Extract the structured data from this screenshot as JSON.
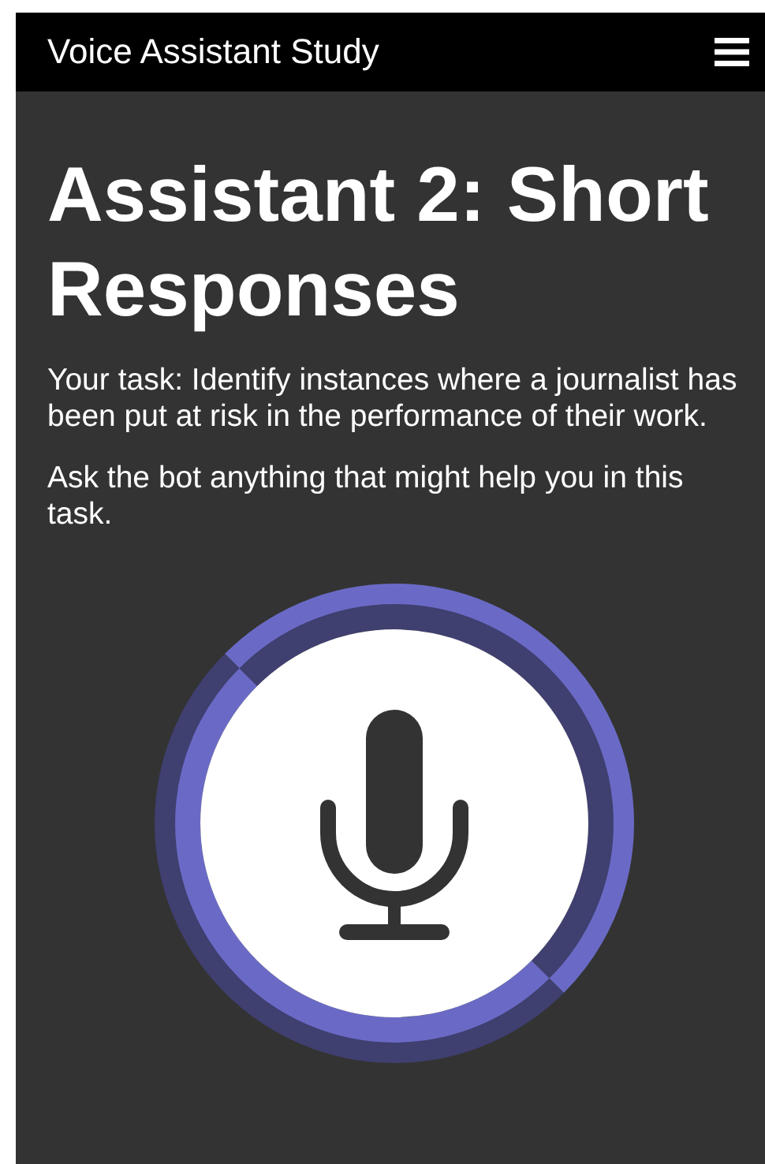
{
  "header": {
    "title": "Voice Assistant Study"
  },
  "heading": "Assistant 2: Short Responses",
  "paragraphs": [
    "Your task: Identify instances where a journalist has been put at risk in the performance of their work.",
    "Ask the bot anything that might help you in this task."
  ]
}
